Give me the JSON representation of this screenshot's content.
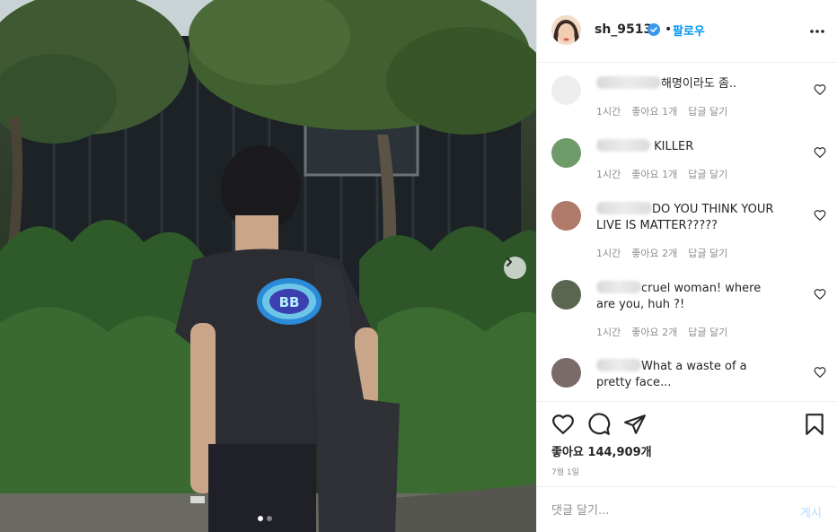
{
  "post": {
    "author": {
      "username": "sh_9513",
      "verified_icon": "verified-badge-icon",
      "separator": "•",
      "follow_label": "팔로우",
      "more_icon": "more-options-icon"
    },
    "image_carousel": {
      "slide_count": 2,
      "current_slide": 1,
      "next_icon": "chevron-right-icon"
    },
    "comments": [
      {
        "text": "해명이라도 좀..",
        "time": "1시간",
        "likes": "좋아요 1개",
        "reply": "답글 달기",
        "avatar_color": "#eeeeee"
      },
      {
        "text": " KILLER",
        "time": "1시간",
        "likes": "좋아요 1개",
        "reply": "답글 달기",
        "avatar_color": "#6f9a6a"
      },
      {
        "text": "DO YOU THINK YOUR LIVE IS MATTER?????",
        "time": "1시간",
        "likes": "좋아요 2개",
        "reply": "답글 달기",
        "avatar_color": "#b07a6a"
      },
      {
        "text": "cruel woman! where are you, huh ?!",
        "time": "1시간",
        "likes": "좋아요 2개",
        "reply": "답글 달기",
        "avatar_color": "#5a6650"
      },
      {
        "text": "What a waste of a pretty face...",
        "time": "",
        "likes": "",
        "reply": "",
        "avatar_color": "#7a6a6a"
      }
    ],
    "actions": {
      "like_icon": "heart-icon",
      "comment_icon": "comment-icon",
      "share_icon": "paper-plane-icon",
      "save_icon": "bookmark-icon"
    },
    "likes_count": "좋아요 144,909개",
    "date": "7월 1일",
    "add_comment": {
      "placeholder": "댓글 달기...",
      "post_label": "게시"
    }
  },
  "colors": {
    "accent": "#0095f6",
    "muted_text": "#8e8e8e",
    "divider": "#efefef",
    "post_disabled": "#b3dbff"
  }
}
